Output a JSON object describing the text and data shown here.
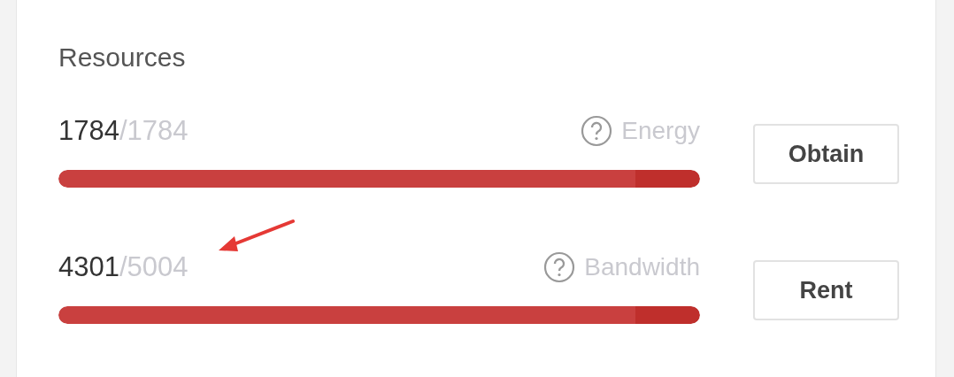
{
  "section": {
    "title": "Resources"
  },
  "resources": [
    {
      "used": "1784",
      "total": "/1784",
      "label": "Energy",
      "level": 1,
      "button": "Obtain"
    },
    {
      "used": "4301",
      "total": "/5004",
      "label": "Bandwidth",
      "level": 1,
      "button": "Rent"
    }
  ]
}
